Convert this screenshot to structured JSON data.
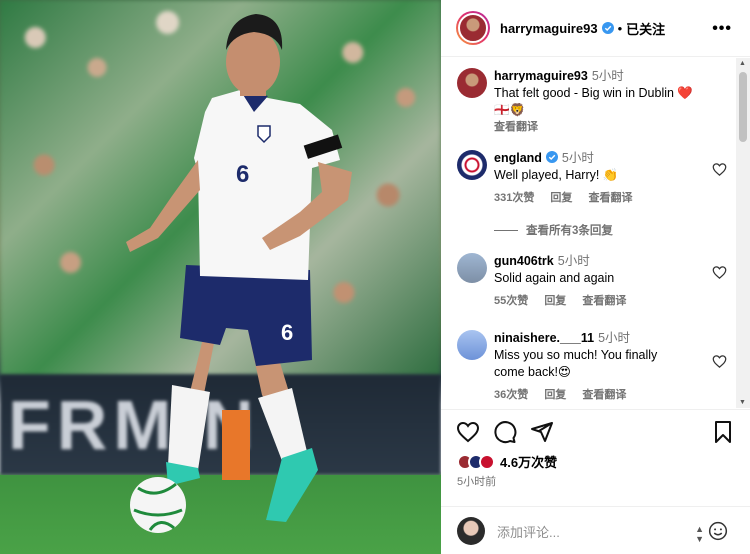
{
  "photo": {
    "board_text": "FRMIN",
    "shirt_number": "6",
    "shorts_number": "6"
  },
  "header": {
    "username": "harrymaguire93",
    "separator": "•",
    "follow_label": "已关注",
    "more_label": "•••"
  },
  "caption": {
    "username": "harrymaguire93",
    "time": "5小时",
    "text": "That felt good - Big win in Dublin ❤️",
    "text_line2": "🏴󠁧󠁢󠁥󠁮󠁧󠁿🦁",
    "translate": "查看翻译"
  },
  "comments": [
    {
      "username": "england",
      "verified": true,
      "time": "5小时",
      "text": "Well played, Harry! 👏",
      "likes": "331次赞",
      "reply": "回复",
      "translate": "查看翻译"
    },
    {
      "username": "gun406trk",
      "verified": false,
      "time": "5小时",
      "text": "Solid again and again",
      "likes": "55次赞",
      "reply": "回复",
      "translate": "查看翻译"
    },
    {
      "username": "ninaishere.___11",
      "verified": false,
      "time": "5小时",
      "text": "Miss you so much! You finally",
      "text_line2": "come back!😍",
      "likes": "36次赞",
      "reply": "回复",
      "translate": "查看翻译"
    }
  ],
  "view_replies": "查看所有3条回复",
  "footer": {
    "likes_count": "4.6万次赞",
    "posted_ago": "5小时前",
    "comment_placeholder": "添加评论..."
  },
  "colors": {
    "verified": "#3897f0",
    "heart": "#ed4956",
    "muted": "#737373"
  }
}
